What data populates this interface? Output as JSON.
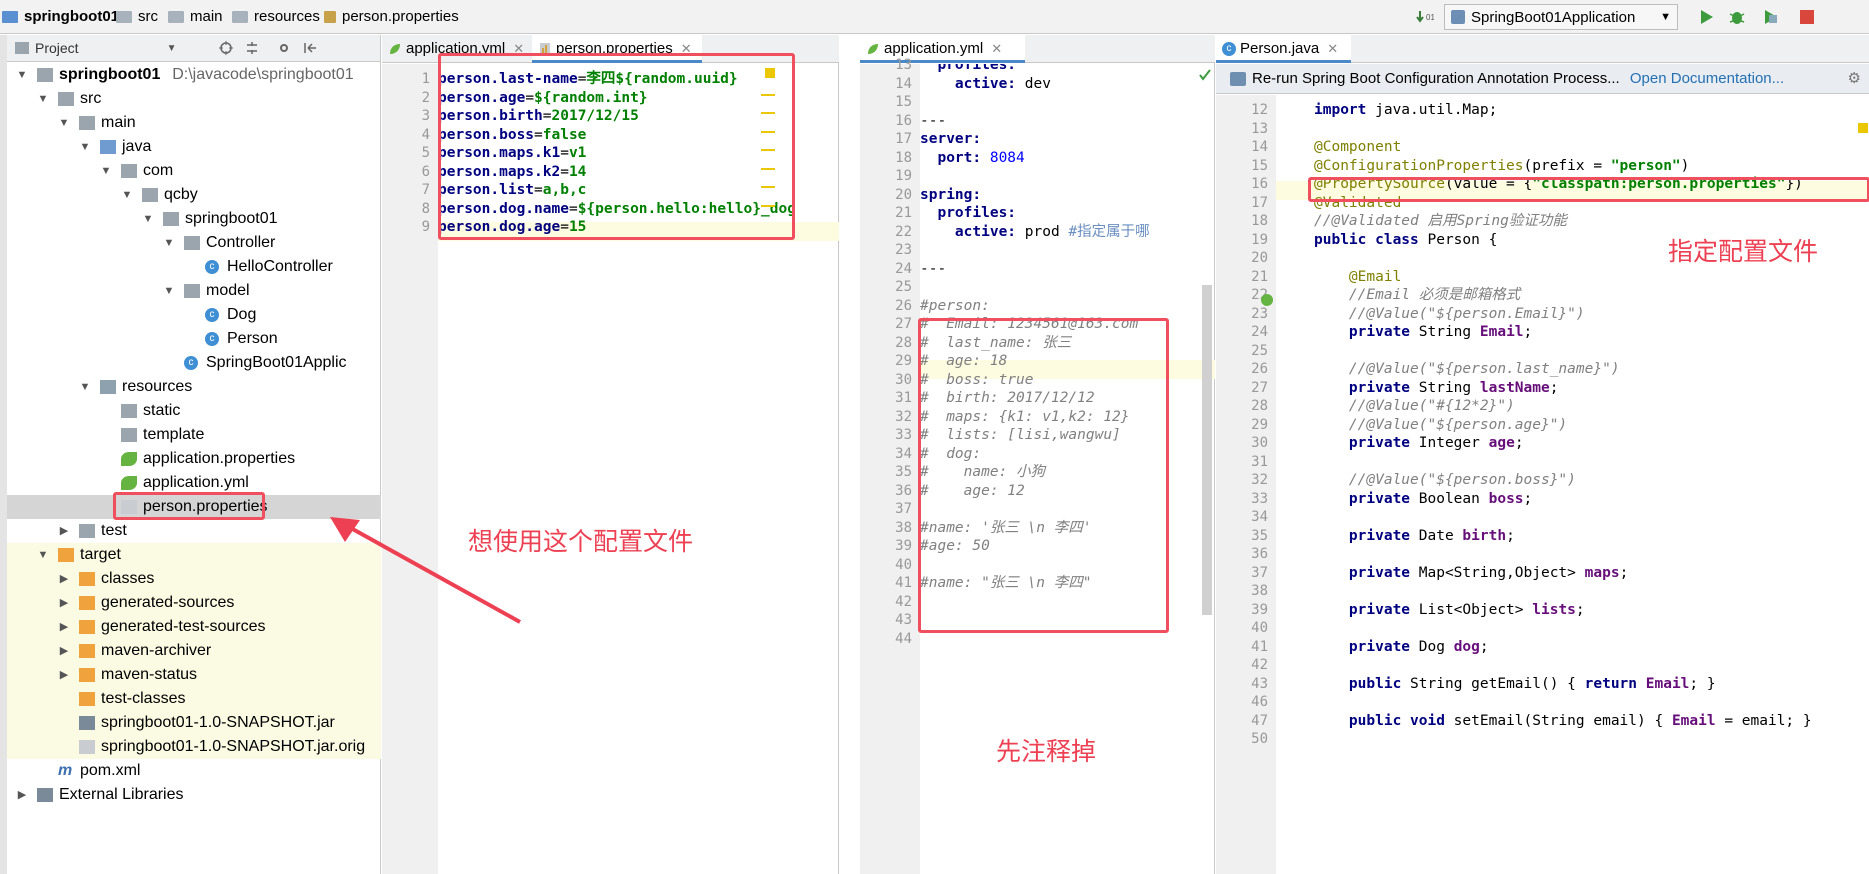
{
  "breadcrumbs": [
    "springboot01",
    "src",
    "main",
    "resources",
    "person.properties"
  ],
  "run_config": "SpringBoot01Application",
  "project_panel": {
    "title": "Project",
    "icons": [
      "project-icon",
      "dropdown-icon",
      "locate-icon",
      "collapse-icon",
      "gear-icon",
      "hide-icon"
    ]
  },
  "tree": [
    {
      "level": 0,
      "label": "springboot01",
      "extra": "D:\\javacode\\springboot01",
      "icon": "module-folder-icon",
      "open": true,
      "bold": true
    },
    {
      "level": 1,
      "label": "src",
      "icon": "folder-icon",
      "open": true
    },
    {
      "level": 2,
      "label": "main",
      "icon": "folder-icon",
      "open": true
    },
    {
      "level": 3,
      "label": "java",
      "icon": "source-folder-icon",
      "open": true
    },
    {
      "level": 4,
      "label": "com",
      "icon": "package-icon",
      "open": true
    },
    {
      "level": 5,
      "label": "qcby",
      "icon": "package-icon",
      "open": true
    },
    {
      "level": 6,
      "label": "springboot01",
      "icon": "package-icon",
      "open": true
    },
    {
      "level": 7,
      "label": "Controller",
      "icon": "package-icon",
      "open": true
    },
    {
      "level": 8,
      "label": "HelloController",
      "icon": "class-icon"
    },
    {
      "level": 7,
      "label": "model",
      "icon": "package-icon",
      "open": true
    },
    {
      "level": 8,
      "label": "Dog",
      "icon": "class-icon"
    },
    {
      "level": 8,
      "label": "Person",
      "icon": "class-icon"
    },
    {
      "level": 7,
      "label": "SpringBoot01Applic",
      "icon": "spring-boot-class-icon"
    },
    {
      "level": 3,
      "label": "resources",
      "icon": "resources-folder-icon",
      "open": true
    },
    {
      "level": 4,
      "label": "static",
      "icon": "folder-icon"
    },
    {
      "level": 4,
      "label": "template",
      "icon": "folder-icon"
    },
    {
      "level": 4,
      "label": "application.properties",
      "icon": "spring-config-icon"
    },
    {
      "level": 4,
      "label": "application.yml",
      "icon": "spring-config-icon"
    },
    {
      "level": 4,
      "label": "person.properties",
      "icon": "properties-file-icon",
      "selected": true
    },
    {
      "level": 2,
      "label": "test",
      "icon": "folder-icon",
      "open": false
    },
    {
      "level": 1,
      "label": "target",
      "icon": "excluded-folder-icon",
      "open": true,
      "yellow": true
    },
    {
      "level": 2,
      "label": "classes",
      "icon": "excluded-folder-icon",
      "open": false,
      "yellow": true
    },
    {
      "level": 2,
      "label": "generated-sources",
      "icon": "excluded-folder-icon",
      "open": false,
      "yellow": true
    },
    {
      "level": 2,
      "label": "generated-test-sources",
      "icon": "excluded-folder-icon",
      "open": false,
      "yellow": true
    },
    {
      "level": 2,
      "label": "maven-archiver",
      "icon": "excluded-folder-icon",
      "open": false,
      "yellow": true
    },
    {
      "level": 2,
      "label": "maven-status",
      "icon": "excluded-folder-icon",
      "open": false,
      "yellow": true
    },
    {
      "level": 2,
      "label": "test-classes",
      "icon": "excluded-folder-icon",
      "yellow": true
    },
    {
      "level": 2,
      "label": "springboot01-1.0-SNAPSHOT.jar",
      "icon": "jar-icon",
      "yellow": true
    },
    {
      "level": 2,
      "label": "springboot01-1.0-SNAPSHOT.jar.orig",
      "icon": "file-icon",
      "yellow": true
    },
    {
      "level": 1,
      "label": "pom.xml",
      "icon": "maven-icon"
    },
    {
      "level": 0,
      "label": "External Libraries",
      "icon": "library-icon",
      "open": false
    }
  ],
  "editor1": {
    "tabs": [
      {
        "label": "application.yml",
        "active": false
      },
      {
        "label": "person.properties",
        "active": true
      }
    ],
    "lines": [
      {
        "n": "1",
        "k": "person.last-name",
        "v": "李四${random.uuid}"
      },
      {
        "n": "2",
        "k": "person.age",
        "v": "${random.int}"
      },
      {
        "n": "3",
        "k": "person.birth",
        "v": "2017/12/15"
      },
      {
        "n": "4",
        "k": "person.boss",
        "v": "false"
      },
      {
        "n": "5",
        "k": "person.maps.k1",
        "v": "v1"
      },
      {
        "n": "6",
        "k": "person.maps.k2",
        "v": "14"
      },
      {
        "n": "7",
        "k": "person.list",
        "v": "a,b,c"
      },
      {
        "n": "8",
        "k": "person.dog.name",
        "v": "${person.hello:hello}_dog"
      },
      {
        "n": "9",
        "k": "person.dog.age",
        "v": "15"
      }
    ]
  },
  "editor2": {
    "tabs": [
      {
        "label": "application.yml",
        "active": true
      }
    ],
    "lines": [
      {
        "n": "13",
        "t": "  profiles:",
        "c": "ykey"
      },
      {
        "n": "14",
        "t": "    active: dev",
        "c": "mix"
      },
      {
        "n": "15",
        "t": "",
        "c": ""
      },
      {
        "n": "16",
        "t": "---",
        "c": "ysep"
      },
      {
        "n": "17",
        "t": "server:",
        "c": "ykey"
      },
      {
        "n": "18",
        "t": "  port: 8084",
        "c": "mixnum"
      },
      {
        "n": "19",
        "t": "",
        "c": ""
      },
      {
        "n": "20",
        "t": "spring:",
        "c": "ykey"
      },
      {
        "n": "21",
        "t": "  profiles:",
        "c": "ykey"
      },
      {
        "n": "22",
        "t": "    active: prod #指定属于哪",
        "c": "mixcom"
      },
      {
        "n": "23",
        "t": "",
        "c": ""
      },
      {
        "n": "24",
        "t": "---",
        "c": "ysep"
      },
      {
        "n": "25",
        "t": "",
        "c": ""
      },
      {
        "n": "26",
        "t": "#person:",
        "c": "ycom"
      },
      {
        "n": "27",
        "t": "#  Email: 1234561@163.com",
        "c": "ycom"
      },
      {
        "n": "28",
        "t": "#  last_name: 张三",
        "c": "ycom"
      },
      {
        "n": "29",
        "t": "#  age: 18",
        "c": "ycom"
      },
      {
        "n": "30",
        "t": "#  boss: true",
        "c": "ycom"
      },
      {
        "n": "31",
        "t": "#  birth: 2017/12/12",
        "c": "ycom"
      },
      {
        "n": "32",
        "t": "#  maps: {k1: v1,k2: 12}",
        "c": "ycom"
      },
      {
        "n": "33",
        "t": "#  lists: [lisi,wangwu]",
        "c": "ycom"
      },
      {
        "n": "34",
        "t": "#  dog:",
        "c": "ycom"
      },
      {
        "n": "35",
        "t": "#    name: 小狗",
        "c": "ycom"
      },
      {
        "n": "36",
        "t": "#    age: 12",
        "c": "ycom"
      },
      {
        "n": "37",
        "t": "",
        "c": ""
      },
      {
        "n": "38",
        "t": "#name: '张三 \\n 李四'",
        "c": "ycom"
      },
      {
        "n": "39",
        "t": "#age: 50",
        "c": "ycom"
      },
      {
        "n": "40",
        "t": "",
        "c": ""
      },
      {
        "n": "41",
        "t": "#name: \"张三 \\n 李四\"",
        "c": "ycom"
      },
      {
        "n": "42",
        "t": "",
        "c": ""
      },
      {
        "n": "43",
        "t": "",
        "c": ""
      },
      {
        "n": "44",
        "t": "",
        "c": ""
      }
    ]
  },
  "editor3": {
    "tabs": [
      {
        "label": "Person.java",
        "active": true
      }
    ],
    "banner": {
      "text": "Re-run Spring Boot Configuration Annotation Process...",
      "link": "Open Documentation..."
    },
    "lines": [
      {
        "n": "12",
        "h": "<span class='jkw'>import</span> java.util.Map;"
      },
      {
        "n": "13",
        "h": ""
      },
      {
        "n": "14",
        "h": "<span class='jann'>@Component</span>"
      },
      {
        "n": "15",
        "h": "<span class='jann'>@ConfigurationProperties</span>(prefix = <span class='jstr'>\"person\"</span>)"
      },
      {
        "n": "16",
        "h": "<span class='jann'>@PropertySource</span>(value = {<span class='jstr'>\"classpath:person.properties\"</span>})"
      },
      {
        "n": "17",
        "h": "<span class='jann'>@Validated</span>"
      },
      {
        "n": "18",
        "h": "<span class='jcom'>//@Validated 启用Spring验证功能</span>"
      },
      {
        "n": "19",
        "h": "<span class='jkw'>public class</span> Person {"
      },
      {
        "n": "20",
        "h": ""
      },
      {
        "n": "21",
        "h": "    <span class='jann'>@Email</span>"
      },
      {
        "n": "22",
        "h": "    <span class='jcom'>//Email 必须是邮箱格式</span>"
      },
      {
        "n": "23",
        "h": "    <span class='jcom'>//@Value(\"${person.Email}\")</span>"
      },
      {
        "n": "24",
        "h": "    <span class='jkw'>private</span> String <span class='jfld'>Email</span>;"
      },
      {
        "n": "25",
        "h": ""
      },
      {
        "n": "26",
        "h": "    <span class='jcom'>//@Value(\"${person.last_name}\")</span>"
      },
      {
        "n": "27",
        "h": "    <span class='jkw'>private</span> String <span class='jfld'>lastName</span>;"
      },
      {
        "n": "28",
        "h": "    <span class='jcom'>//@Value(\"#{12*2}\")</span>"
      },
      {
        "n": "29",
        "h": "    <span class='jcom'>//@Value(\"${person.age}\")</span>"
      },
      {
        "n": "30",
        "h": "    <span class='jkw'>private</span> Integer <span class='jfld'>age</span>;"
      },
      {
        "n": "31",
        "h": ""
      },
      {
        "n": "32",
        "h": "    <span class='jcom'>//@Value(\"${person.boss}\")</span>"
      },
      {
        "n": "33",
        "h": "    <span class='jkw'>private</span> Boolean <span class='jfld'>boss</span>;"
      },
      {
        "n": "34",
        "h": ""
      },
      {
        "n": "35",
        "h": "    <span class='jkw'>private</span> Date <span class='jfld'>birth</span>;"
      },
      {
        "n": "36",
        "h": ""
      },
      {
        "n": "37",
        "h": "    <span class='jkw'>private</span> Map&lt;String,Object&gt; <span class='jfld'>maps</span>;"
      },
      {
        "n": "38",
        "h": ""
      },
      {
        "n": "39",
        "h": "    <span class='jkw'>private</span> List&lt;Object&gt; <span class='jfld'>lists</span>;"
      },
      {
        "n": "40",
        "h": ""
      },
      {
        "n": "41",
        "h": "    <span class='jkw'>private</span> Dog <span class='jfld'>dog</span>;"
      },
      {
        "n": "42",
        "h": ""
      },
      {
        "n": "43",
        "h": "    <span class='jkw'>public</span> String getEmail() { <span class='jkw'>return</span> <span class='jfld'>Email</span>; }"
      },
      {
        "n": "46",
        "h": ""
      },
      {
        "n": "47",
        "h": "    <span class='jkw'>public void</span> setEmail(String email) { <span class='jfld'>Email</span> = email; }"
      },
      {
        "n": "50",
        "h": ""
      }
    ]
  },
  "annotations": {
    "use_this": "想使用这个配置文件",
    "comment_out": "先注释掉",
    "specify": "指定配置文件"
  },
  "colors": {
    "accent": "#4a88c7",
    "annotation_red": "#ee4053"
  }
}
